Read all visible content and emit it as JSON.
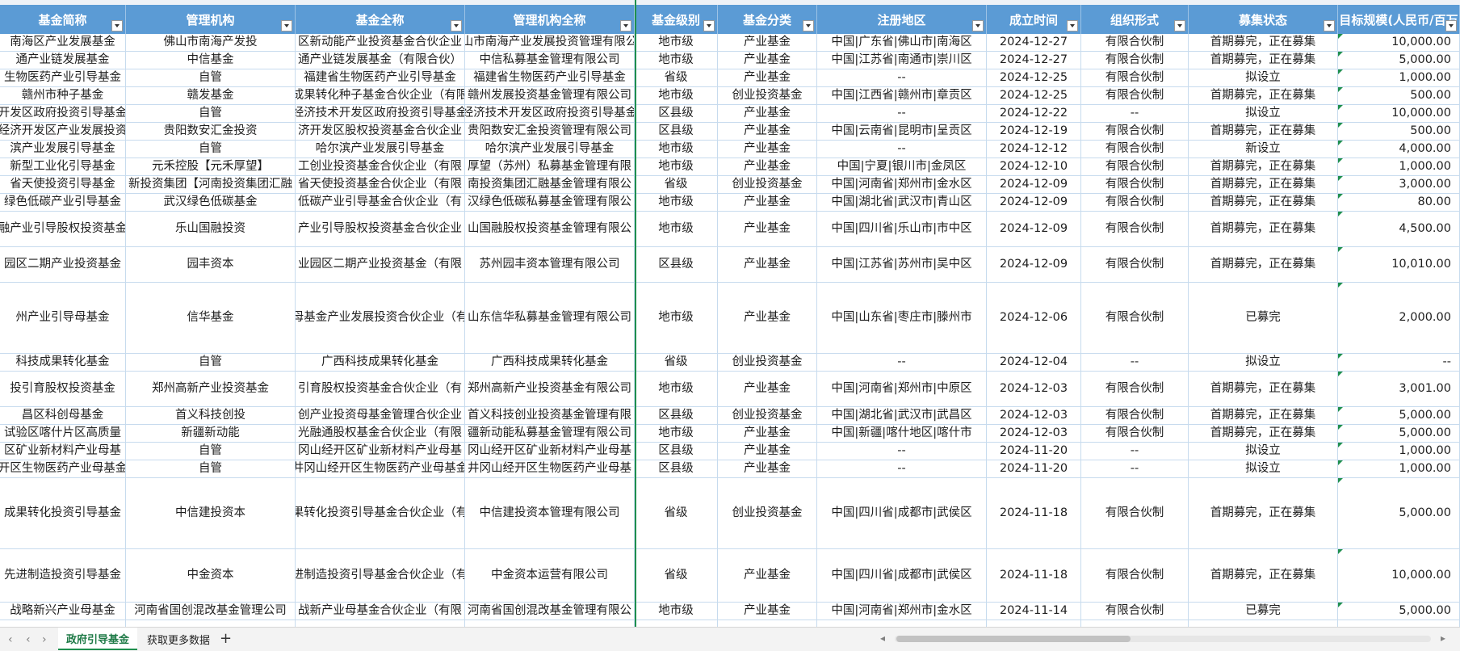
{
  "sheet_tabs": [
    {
      "label": "政府引导基金",
      "active": true
    },
    {
      "label": "获取更多数据",
      "active": false
    }
  ],
  "add_tab_label": "+",
  "nav": {
    "first": "‹",
    "prev": "‹",
    "next": "›",
    "last": "›|"
  },
  "headers": [
    {
      "label": "基金简称",
      "w": 156
    },
    {
      "label": "管理机构",
      "w": 210
    },
    {
      "label": "基金全称",
      "w": 210
    },
    {
      "label": "管理机构全称",
      "w": 210
    },
    {
      "label": "基金级别",
      "w": 103
    },
    {
      "label": "基金分类",
      "w": 123
    },
    {
      "label": "注册地区",
      "w": 210
    },
    {
      "label": "成立时间",
      "w": 117
    },
    {
      "label": "组织形式",
      "w": 133
    },
    {
      "label": "募集状态",
      "w": 185
    },
    {
      "label": "目标规模(人民币/百万",
      "w": 151
    }
  ],
  "rows": [
    {
      "h": 22,
      "cells": [
        "南海区产业发展基金",
        "佛山市南海产发投",
        "区新动能产业投资基金合伙企业",
        "山市南海产业发展投资管理有限公",
        "地市级",
        "产业基金",
        "中国|广东省|佛山市|南海区",
        "2024-12-27",
        "有限合伙制",
        "首期募完，正在募集",
        "10,000.00"
      ]
    },
    {
      "h": 22,
      "cells": [
        "通产业链发展基金",
        "中信基金",
        "通产业链发展基金（有限合伙）",
        "中信私募基金管理有限公司",
        "地市级",
        "产业基金",
        "中国|江苏省|南通市|崇川区",
        "2024-12-27",
        "有限合伙制",
        "首期募完，正在募集",
        "5,000.00"
      ]
    },
    {
      "h": 22,
      "cells": [
        "生物医药产业引导基金",
        "自管",
        "福建省生物医药产业引导基金",
        "福建省生物医药产业引导基金",
        "省级",
        "产业基金",
        "--",
        "2024-12-25",
        "有限合伙制",
        "拟设立",
        "1,000.00"
      ]
    },
    {
      "h": 22,
      "cells": [
        "赣州市种子基金",
        "赣发基金",
        "成果转化种子基金合伙企业（有限",
        "赣州发展投资基金管理有限公司",
        "地市级",
        "创业投资基金",
        "中国|江西省|赣州市|章贡区",
        "2024-12-25",
        "有限合伙制",
        "首期募完，正在募集",
        "500.00"
      ]
    },
    {
      "h": 22,
      "cells": [
        "开发区政府投资引导基金",
        "自管",
        "经济技术开发区政府投资引导基金",
        "经济技术开发区政府投资引导基金",
        "区县级",
        "产业基金",
        "--",
        "2024-12-22",
        "--",
        "拟设立",
        "10,000.00"
      ]
    },
    {
      "h": 22,
      "cells": [
        "经济开发区产业发展投资",
        "贵阳数安汇金投资",
        "济开发区股权投资基金合伙企业",
        "贵阳数安汇金投资管理有限公司",
        "区县级",
        "产业基金",
        "中国|云南省|昆明市|呈贡区",
        "2024-12-19",
        "有限合伙制",
        "首期募完，正在募集",
        "500.00"
      ]
    },
    {
      "h": 22,
      "cells": [
        "滨产业发展引导基金",
        "自管",
        "哈尔滨产业发展引导基金",
        "哈尔滨产业发展引导基金",
        "地市级",
        "产业基金",
        "--",
        "2024-12-12",
        "有限合伙制",
        "新设立",
        "4,000.00"
      ]
    },
    {
      "h": 22,
      "cells": [
        "新型工业化引导基金",
        "元禾控股【元禾厚望】",
        "工创业投资基金合伙企业（有限",
        "厚望（苏州）私募基金管理有限",
        "地市级",
        "产业基金",
        "中国|宁夏|银川市|金凤区",
        "2024-12-10",
        "有限合伙制",
        "首期募完，正在募集",
        "1,000.00"
      ]
    },
    {
      "h": 22,
      "cells": [
        "省天使投资引导基金",
        "新投资集团【河南投资集团汇融",
        "省天使投资基金合伙企业（有限",
        "南投资集团汇融基金管理有限公",
        "省级",
        "创业投资基金",
        "中国|河南省|郑州市|金水区",
        "2024-12-09",
        "有限合伙制",
        "首期募完，正在募集",
        "3,000.00"
      ]
    },
    {
      "h": 22,
      "cells": [
        "绿色低碳产业引导基金",
        "武汉绿色低碳基金",
        "低碳产业引导基金合伙企业（有",
        "汉绿色低碳私募基金管理有限公",
        "地市级",
        "产业基金",
        "中国|湖北省|武汉市|青山区",
        "2024-12-09",
        "有限合伙制",
        "首期募完，正在募集",
        "80.00"
      ]
    },
    {
      "h": 44,
      "cells": [
        "融产业引导股权投资基金",
        "乐山国融投资",
        "产业引导股权投资基金合伙企业",
        "山国融股权投资基金管理有限公",
        "地市级",
        "产业基金",
        "中国|四川省|乐山市|市中区",
        "2024-12-09",
        "有限合伙制",
        "首期募完，正在募集",
        "4,500.00"
      ]
    },
    {
      "h": 44,
      "cells": [
        "园区二期产业投资基金",
        "园丰资本",
        "业园区二期产业投资基金（有限",
        "苏州园丰资本管理有限公司",
        "区县级",
        "产业基金",
        "中国|江苏省|苏州市|吴中区",
        "2024-12-09",
        "有限合伙制",
        "首期募完，正在募集",
        "10,010.00"
      ]
    },
    {
      "h": 88,
      "cells": [
        "州产业引导母基金",
        "信华基金",
        "母基金产业发展投资合伙企业（有",
        "山东信华私募基金管理有限公司",
        "地市级",
        "产业基金",
        "中国|山东省|枣庄市|滕州市",
        "2024-12-06",
        "有限合伙制",
        "已募完",
        "2,000.00"
      ]
    },
    {
      "h": 22,
      "cells": [
        "科技成果转化基金",
        "自管",
        "广西科技成果转化基金",
        "广西科技成果转化基金",
        "省级",
        "创业投资基金",
        "--",
        "2024-12-04",
        "--",
        "拟设立",
        "--"
      ]
    },
    {
      "h": 44,
      "cells": [
        "投引育股权投资基金",
        "郑州高新产业投资基金",
        "引育股权投资基金合伙企业（有",
        "郑州高新产业投资基金有限公司",
        "地市级",
        "产业基金",
        "中国|河南省|郑州市|中原区",
        "2024-12-03",
        "有限合伙制",
        "首期募完，正在募集",
        "3,001.00"
      ]
    },
    {
      "h": 22,
      "cells": [
        "昌区科创母基金",
        "首义科技创投",
        "创产业投资母基金管理合伙企业",
        "首义科技创业投资基金管理有限",
        "区县级",
        "创业投资基金",
        "中国|湖北省|武汉市|武昌区",
        "2024-12-03",
        "有限合伙制",
        "首期募完，正在募集",
        "5,000.00"
      ]
    },
    {
      "h": 22,
      "cells": [
        "试验区喀什片区高质量",
        "新疆新动能",
        "光融通股权基金合伙企业（有限",
        "疆新动能私募基金管理有限公司",
        "地市级",
        "产业基金",
        "中国|新疆|喀什地区|喀什市",
        "2024-12-03",
        "有限合伙制",
        "首期募完，正在募集",
        "5,000.00"
      ]
    },
    {
      "h": 22,
      "cells": [
        "区矿业新材料产业母基",
        "自管",
        "冈山经开区矿业新材料产业母基",
        "冈山经开区矿业新材料产业母基",
        "区县级",
        "产业基金",
        "--",
        "2024-11-20",
        "--",
        "拟设立",
        "1,000.00"
      ]
    },
    {
      "h": 22,
      "cells": [
        "开区生物医药产业母基金",
        "自管",
        "井冈山经开区生物医药产业母基金",
        "井冈山经开区生物医药产业母基",
        "区县级",
        "产业基金",
        "--",
        "2024-11-20",
        "--",
        "拟设立",
        "1,000.00"
      ]
    },
    {
      "h": 88,
      "cells": [
        "成果转化投资引导基金",
        "中信建投资本",
        "果转化投资引导基金合伙企业（有",
        "中信建投资本管理有限公司",
        "省级",
        "创业投资基金",
        "中国|四川省|成都市|武侯区",
        "2024-11-18",
        "有限合伙制",
        "首期募完，正在募集",
        "5,000.00"
      ]
    },
    {
      "h": 66,
      "cells": [
        "先进制造投资引导基金",
        "中金资本",
        "进制造投资引导基金合伙企业（有",
        "中金资本运营有限公司",
        "省级",
        "产业基金",
        "中国|四川省|成都市|武侯区",
        "2024-11-18",
        "有限合伙制",
        "首期募完，正在募集",
        "10,000.00"
      ]
    },
    {
      "h": 22,
      "cells": [
        "战略新兴产业母基金",
        "河南省国创混改基金管理公司",
        "战新产业母基金合伙企业（有限",
        "河南省国创混改基金管理有限公",
        "地市级",
        "产业基金",
        "中国|河南省|郑州市|金水区",
        "2024-11-14",
        "有限合伙制",
        "已募完",
        "5,000.00"
      ]
    },
    {
      "h": 22,
      "cells": [
        "",
        "",
        "",
        "",
        "",
        "",
        "",
        "",
        "",
        "",
        ""
      ]
    }
  ]
}
